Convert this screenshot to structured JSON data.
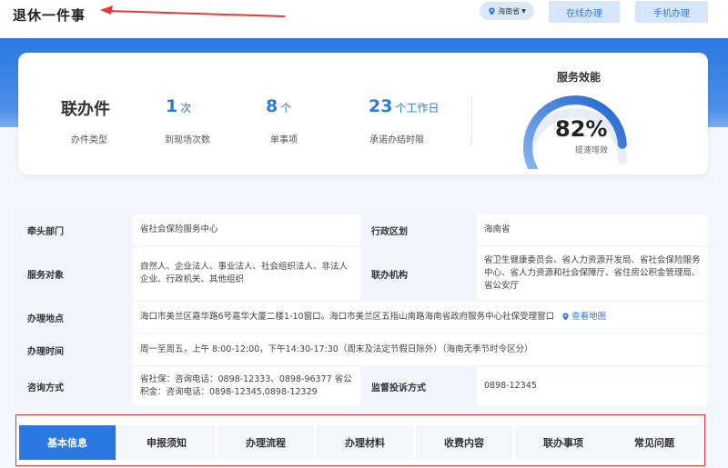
{
  "header": {
    "title": "退休一件事",
    "region": "海南省",
    "online_btn": "在线办理",
    "mobile_btn": "手机办理"
  },
  "summary": {
    "type_value": "联办件",
    "type_caption": "办件类型",
    "visits_value": "1",
    "visits_unit": "次",
    "visits_caption": "到现场次数",
    "items_value": "8",
    "items_unit": "个",
    "items_caption": "单事项",
    "days_value": "23",
    "days_unit": "个工作日",
    "days_caption": "承诺办结时限",
    "gauge_title": "服务效能",
    "gauge_percent": "82%",
    "gauge_fraction": 0.82,
    "gauge_caption": "提速增效"
  },
  "info": {
    "lead_dept_label": "牵头部门",
    "lead_dept_value": "省社会保险服务中心",
    "admin_area_label": "行政区划",
    "admin_area_value": "海南省",
    "service_target_label": "服务对象",
    "service_target_value": "自然人、企业法人、事业法人、社会组织法人、非法人企业、行政机关、其他组织",
    "joint_agency_label": "联办机构",
    "joint_agency_value": "省卫生健康委员会、省人力资源开发局、省社会保险服务中心、省人力资源和社会保障厅、省住房公积金管理局、省公安厅",
    "location_label": "办理地点",
    "location_value": "海口市美兰区嘉华路6号嘉华大厦二楼1-10窗口。海口市美兰区五指山南路海南省政府服务中心社保受理窗口",
    "map_link": "查看地图",
    "hours_label": "办理时间",
    "hours_value": "周一至周五，上午 8:00-12:00，下午14:30-17:30（周末及法定节假日除外）（海南无季节时令区分）",
    "consult_label": "咨询方式",
    "consult_value": "省社保：咨询电话：0898-12333、0898-96377 省公积金：咨询电话：0898-12345,0898-12329",
    "complaint_label": "监督投诉方式",
    "complaint_value": "0898-12345"
  },
  "tabs": [
    "基本信息",
    "申报须知",
    "办理流程",
    "办理材料",
    "收费内容",
    "联办事项",
    "常见问题"
  ],
  "colors": {
    "primary": "#2b78e0",
    "highlight_border": "#e53935",
    "arrow": "#e53935"
  }
}
